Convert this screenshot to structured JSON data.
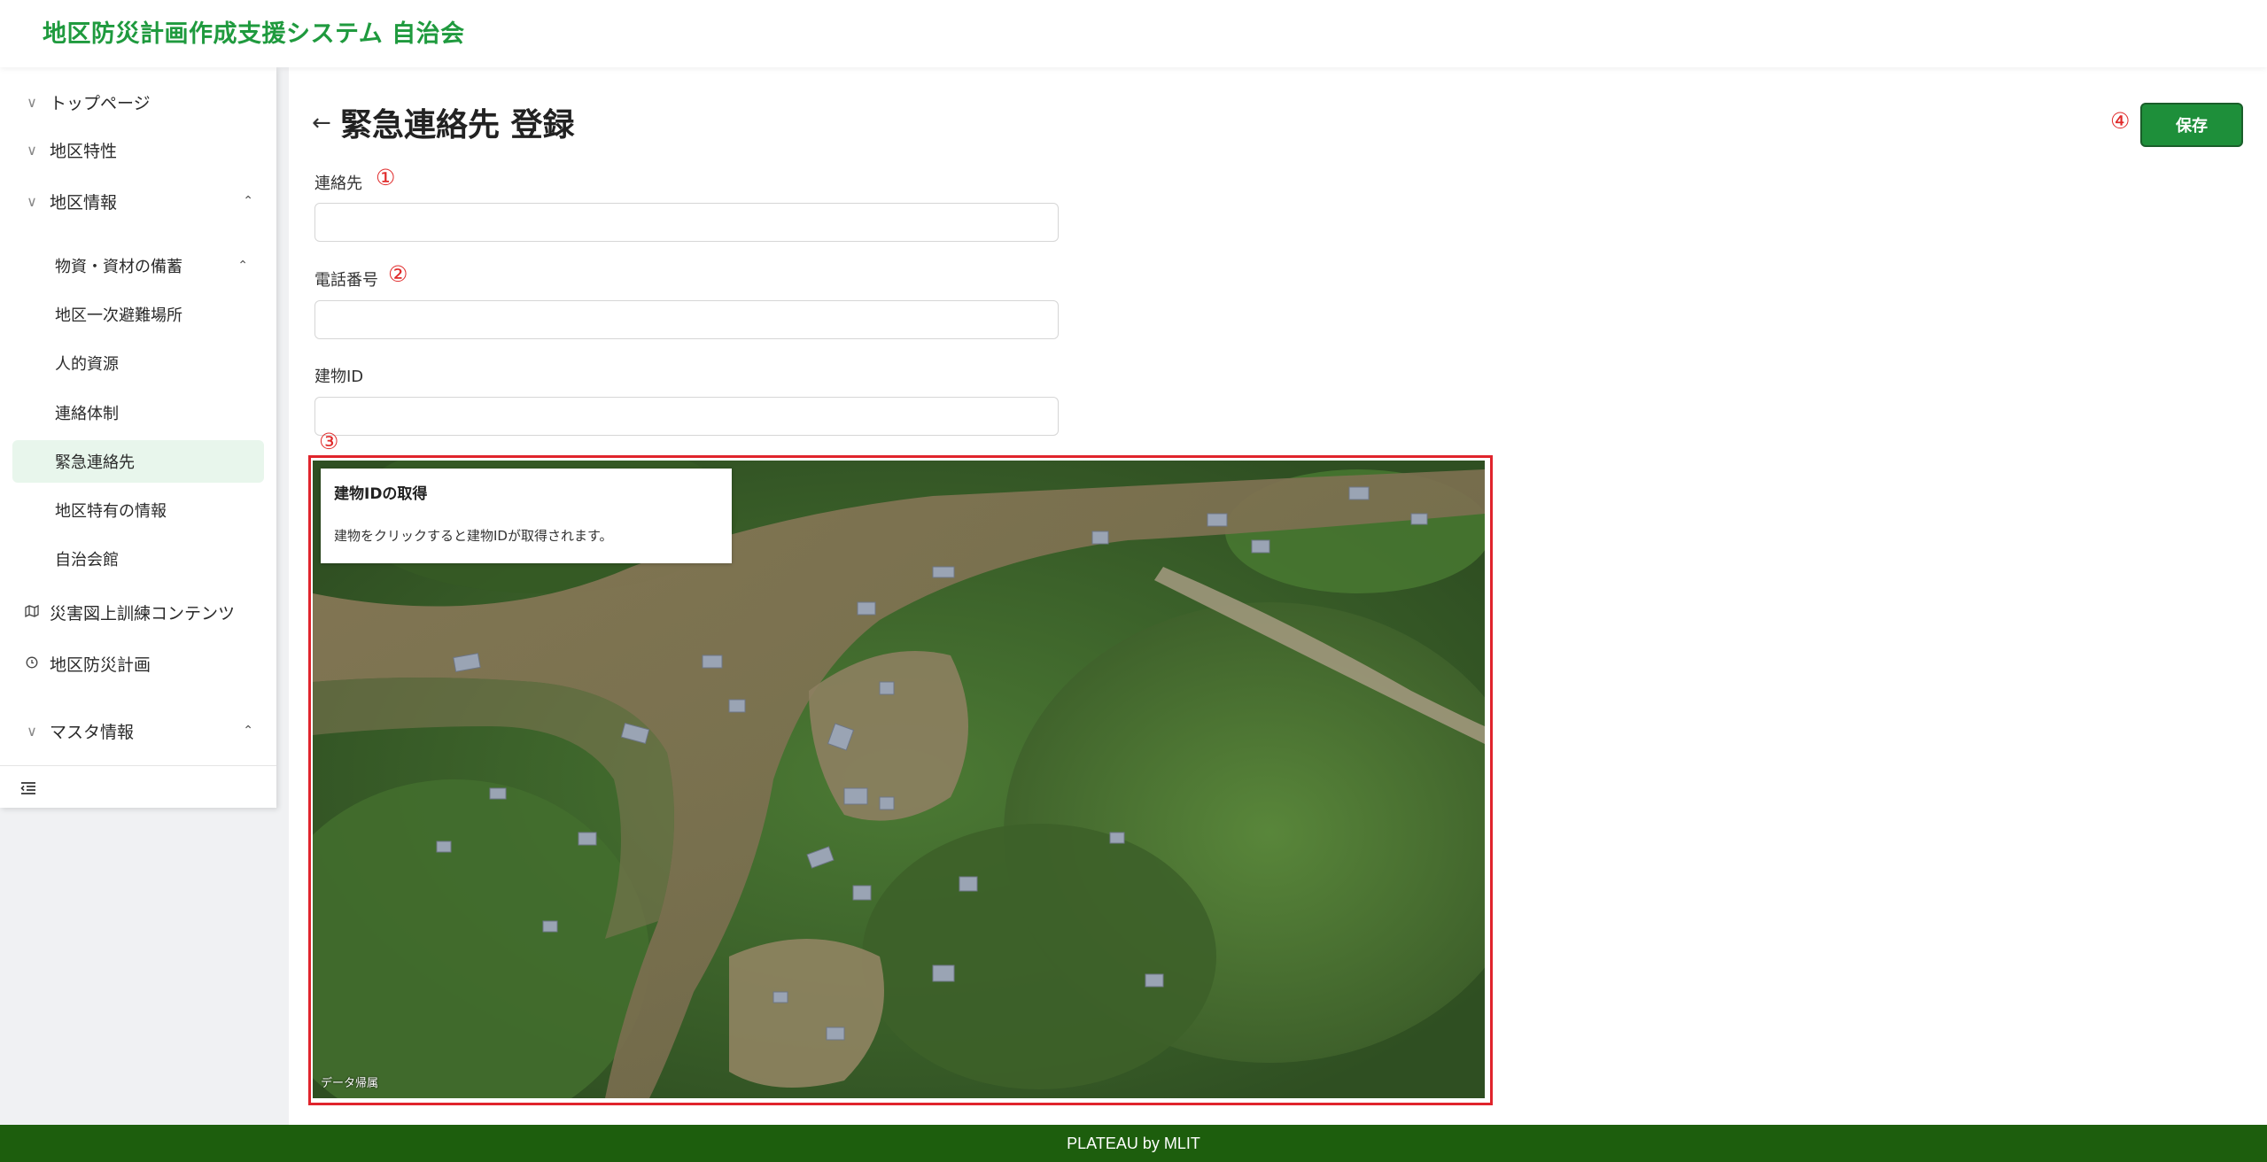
{
  "app": {
    "title": "地区防災計画作成支援システム 自治会"
  },
  "sidebar": {
    "items": [
      {
        "label": "トップページ",
        "icon": "chevron-down-icon"
      },
      {
        "label": "地区特性",
        "icon": "chevron-down-icon"
      },
      {
        "label": "地区情報",
        "icon": "chevron-down-icon",
        "expanded": true
      },
      {
        "label": "災害図上訓練コンテンツ",
        "icon": "map-icon"
      },
      {
        "label": "地区防災計画",
        "icon": "clock-icon"
      },
      {
        "label": "マスタ情報",
        "icon": "chevron-down-icon",
        "expanded": true
      }
    ],
    "sub_items": [
      {
        "label": "物資・資材の備蓄",
        "expanded": true
      },
      {
        "label": "地区一次避難場所"
      },
      {
        "label": "人的資源"
      },
      {
        "label": "連絡体制"
      },
      {
        "label": "緊急連絡先",
        "active": true
      },
      {
        "label": "地区特有の情報"
      },
      {
        "label": "自治会館"
      }
    ],
    "collapse_icon": "collapse-menu-icon"
  },
  "page": {
    "back_icon": "arrow-left-icon",
    "title": "緊急連絡先 登録",
    "save_label": "保存",
    "markers": [
      "①",
      "②",
      "③",
      "④"
    ]
  },
  "form": {
    "contact": {
      "label": "連絡先",
      "value": ""
    },
    "phone": {
      "label": "電話番号",
      "value": ""
    },
    "building_id": {
      "label": "建物ID",
      "value": ""
    }
  },
  "map": {
    "popup_title": "建物IDの取得",
    "popup_text": "建物をクリックすると建物IDが取得されます。",
    "attribution": "データ帰属",
    "highlight_color": "#e0242c"
  },
  "footer": {
    "text": "PLATEAU by MLIT"
  },
  "colors": {
    "brand": "#1f9a3e",
    "footer": "#1d5e0d",
    "active_bg": "#e8f6ec",
    "marker": "#e02a2a"
  }
}
